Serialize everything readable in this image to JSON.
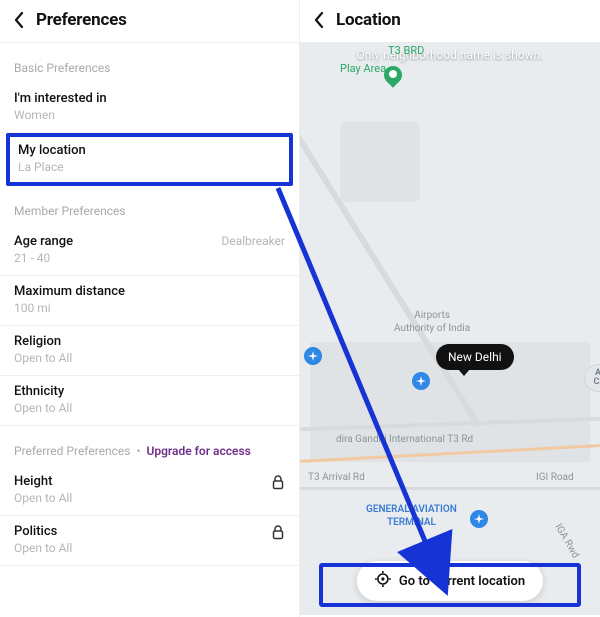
{
  "left": {
    "title": "Preferences",
    "sections": {
      "basic": {
        "title": "Basic Preferences",
        "rows": {
          "interested": {
            "label": "I'm interested in",
            "value": "Women"
          },
          "location": {
            "label": "My location",
            "value": "La Place"
          }
        }
      },
      "member": {
        "title": "Member Preferences",
        "rows": {
          "age": {
            "label": "Age range",
            "value": "21 - 40",
            "aside": "Dealbreaker"
          },
          "distance": {
            "label": "Maximum distance",
            "value": "100 mi"
          },
          "religion": {
            "label": "Religion",
            "value": "Open to All"
          },
          "ethnicity": {
            "label": "Ethnicity",
            "value": "Open to All"
          }
        }
      },
      "preferred": {
        "title_prefix": "Preferred Preferences",
        "dot": "•",
        "upgrade": "Upgrade for access",
        "rows": {
          "height": {
            "label": "Height",
            "value": "Open to All"
          },
          "politics": {
            "label": "Politics",
            "value": "Open to All"
          }
        }
      }
    }
  },
  "right": {
    "title": "Location",
    "note": "Only neighborhood name is shown.",
    "city_chip": "New Delhi",
    "goto_label": "Go to current location",
    "map_labels": {
      "t3_brd": "T3 BRD",
      "play_area": "Play Area",
      "airports_auth": "Airports\nAuthority of India",
      "igi_t3": "dira Gandhi International T3 Rd",
      "t3_arrival": "T3 Arrival Rd",
      "gen_av": "GENERAL AVIATION\nTERMINAL",
      "igi_road": "IGI Road",
      "iga_rwd": "IGA Rwd",
      "a_cr": "A\nCr"
    }
  },
  "colors": {
    "highlight": "#1633d6",
    "poi_blue": "#2f87e6",
    "poi_green": "#2aa866"
  }
}
